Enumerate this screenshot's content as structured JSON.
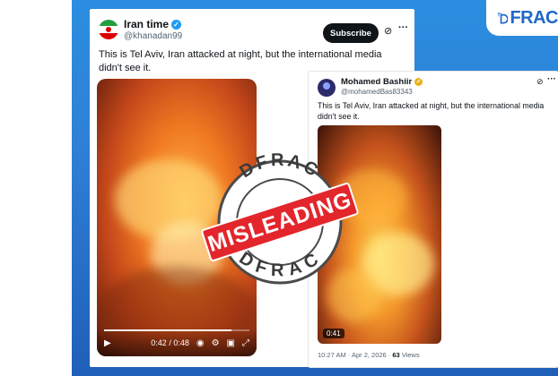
{
  "brand": {
    "logo_text": "FRAC"
  },
  "tweet1": {
    "name": "Iran time",
    "handle": "@khanadan99",
    "subscribe_label": "Subscribe",
    "text": "This is Tel Aviv, Iran attacked at night, but the international media didn't see it.",
    "video": {
      "time": "0:42 / 0:48",
      "progress": 0.875
    }
  },
  "tweet2": {
    "name": "Mohamed Bashiir",
    "handle": "@mohamedBas83343",
    "text": "This is Tel Aviv, Iran attacked at night, but the international media didn't see it.",
    "video": {
      "duration": "0:41"
    },
    "meta": {
      "time": "10:27 AM · Apr 2, 2026 · ",
      "views_count": "63",
      "views_label": " Views"
    }
  },
  "stamp": {
    "label": "MISLEADING",
    "org_top": "DFRAC",
    "org_bottom": "DFRAC",
    "color": "#e3262c"
  },
  "colors": {
    "accent": "#1d9bf0",
    "stamp_red": "#e3262c",
    "bg_blue": "#2f7fd6"
  }
}
